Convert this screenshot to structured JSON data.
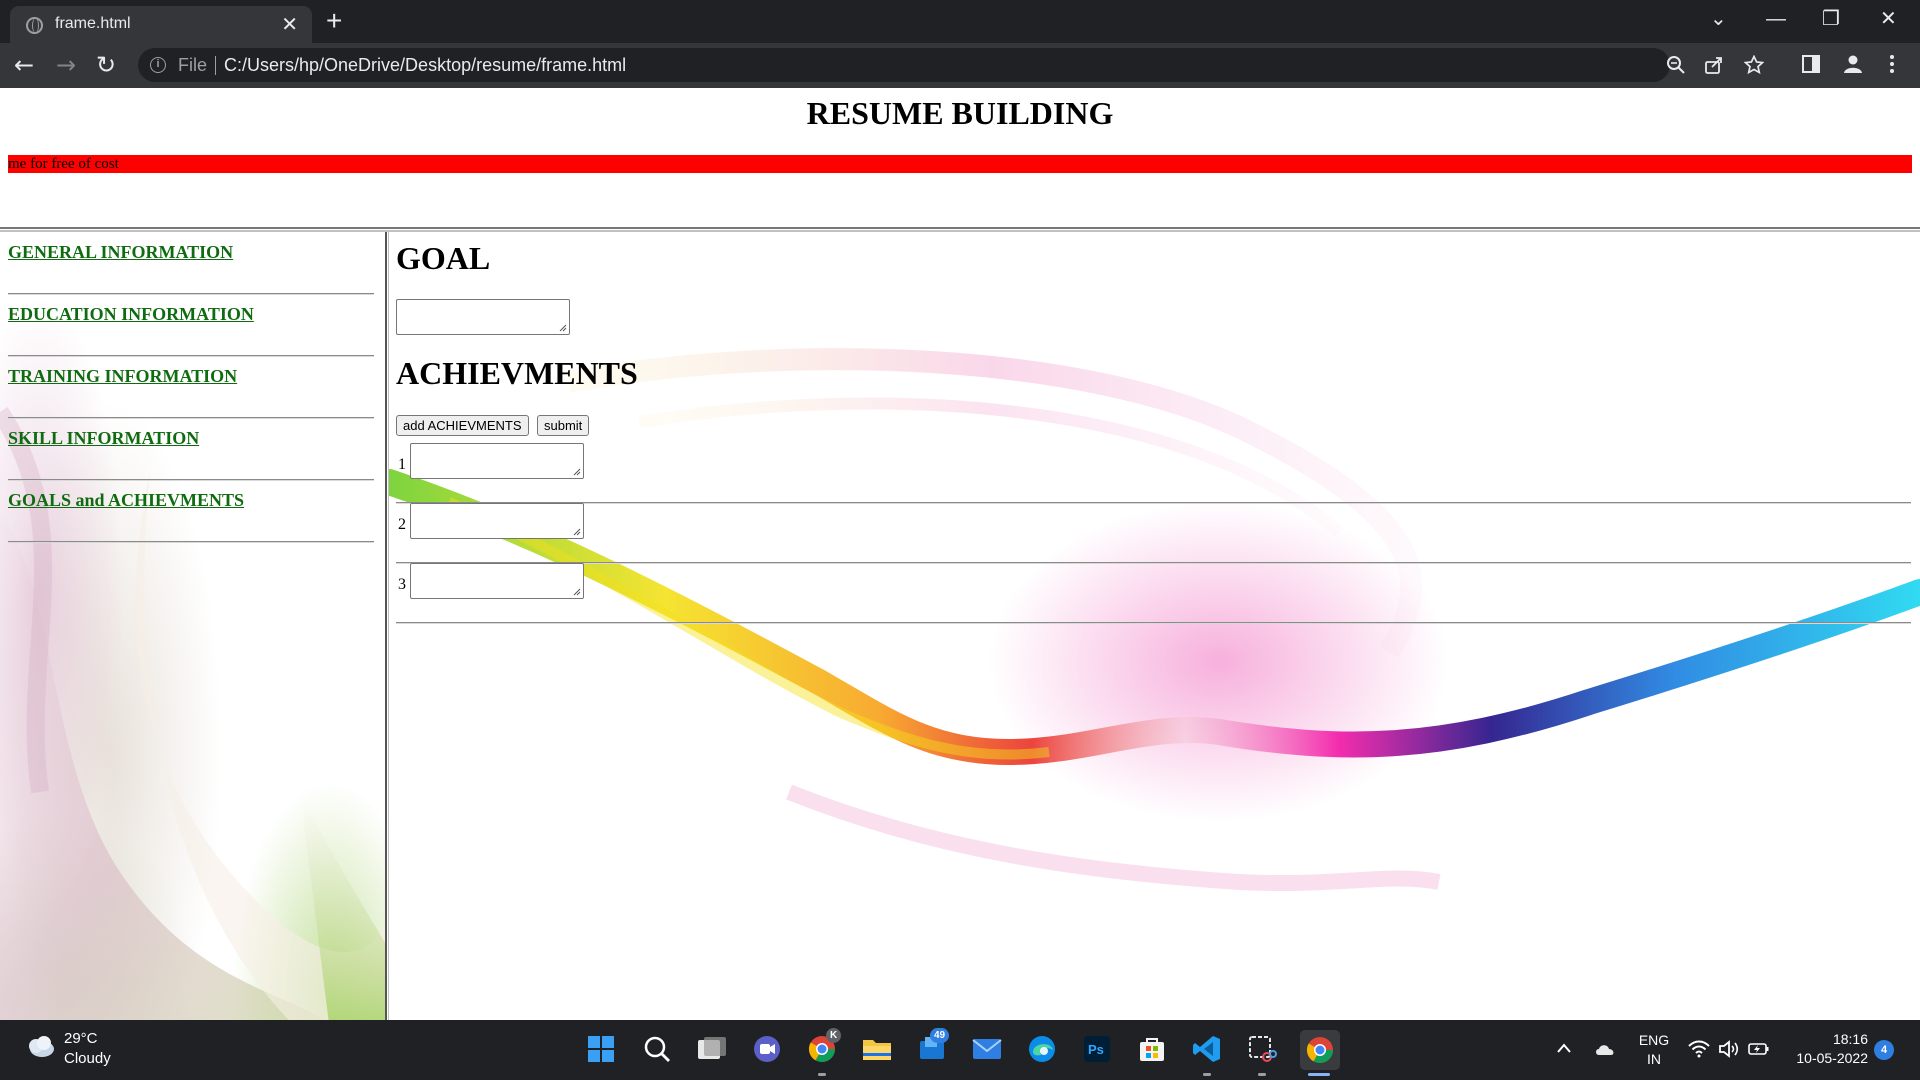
{
  "browser": {
    "tab_title": "frame.html",
    "tab_close": "✕",
    "new_tab": "+",
    "window_controls": {
      "dropdown": "⌄",
      "minimize": "—",
      "restore": "❐",
      "close": "✕"
    },
    "nav": {
      "back": "←",
      "forward": "→",
      "reload": "↻"
    },
    "omnibox": {
      "scheme": "File",
      "url": "C:/Users/hp/OneDrive/Desktop/resume/frame.html",
      "info": "i"
    },
    "icons": [
      "zoom-icon",
      "share-icon",
      "star-icon",
      "side-panel-icon",
      "profile-icon",
      "menu-icon"
    ]
  },
  "page": {
    "title": "RESUME BUILDING",
    "marquee_text": "me for free of cost",
    "nav_links": [
      {
        "label": "GENERAL INFORMATION"
      },
      {
        "label": "EDUCATION INFORMATION"
      },
      {
        "label": "TRAINING INFORMATION"
      },
      {
        "label": "SKILL INFORMATION"
      },
      {
        "label": "GOALS and ACHIEVMENTS"
      }
    ],
    "goal_heading": "GOAL",
    "goal_value": "",
    "achievements_heading": "ACHIEVMENTS",
    "add_button": "add ACHIEVMENTS",
    "submit_button": "submit",
    "achievements": [
      {
        "num": "1",
        "value": ""
      },
      {
        "num": "2",
        "value": ""
      },
      {
        "num": "3",
        "value": ""
      }
    ]
  },
  "taskbar": {
    "weather_temp": "29°C",
    "weather_desc": "Cloudy",
    "mail_badge": "49",
    "chrome_badge": "K",
    "language_line1": "ENG",
    "language_line2": "IN",
    "time": "18:16",
    "date": "10-05-2022",
    "notifications": "4",
    "colors": {
      "windows_blue": "#3aa0f5",
      "chrome_active": "#8ab4f8"
    }
  }
}
